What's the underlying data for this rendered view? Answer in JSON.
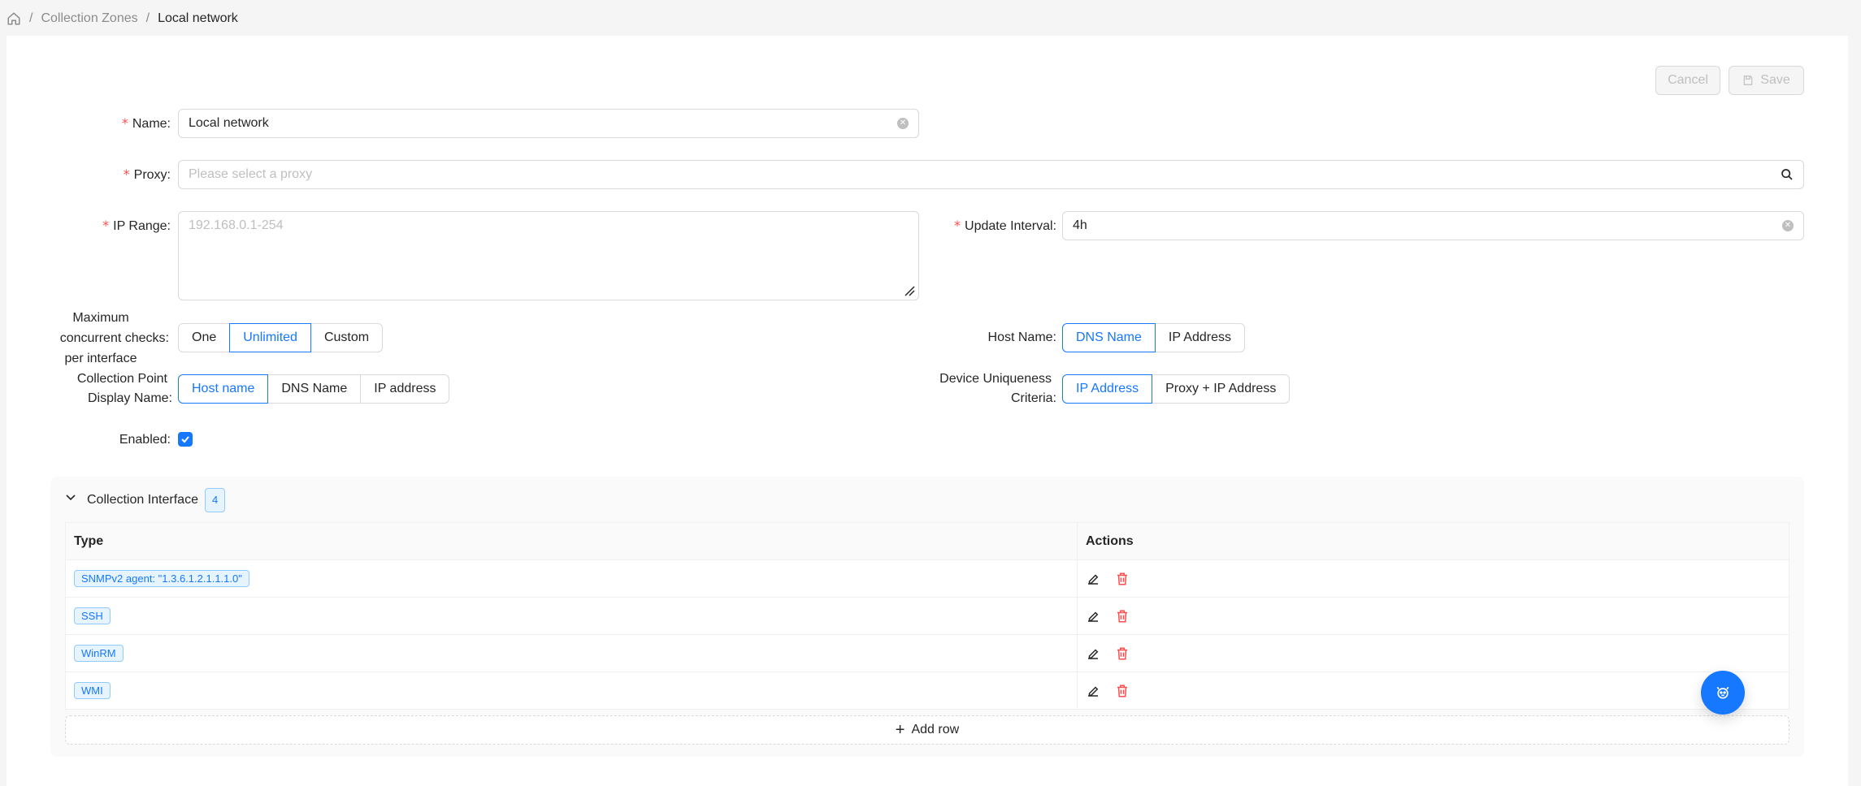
{
  "breadcrumb": {
    "home_icon": "home-icon",
    "items": [
      "Collection Zones",
      "Local network"
    ],
    "separator": "/"
  },
  "toolbar": {
    "cancel_label": "Cancel",
    "save_label": "Save"
  },
  "form": {
    "name": {
      "label": "Name",
      "value": "Local network"
    },
    "proxy": {
      "label": "Proxy",
      "placeholder": "Please select a proxy"
    },
    "ip_range": {
      "label": "IP Range",
      "placeholder": "192.168.0.1-254"
    },
    "update_interval": {
      "label": "Update Interval",
      "value": "4h"
    },
    "max_checks": {
      "label_lines": [
        "Maximum",
        "concurrent checks",
        "per interface"
      ],
      "options": [
        "One",
        "Unlimited",
        "Custom"
      ],
      "selected": "Unlimited"
    },
    "host_name": {
      "label": "Host Name",
      "options": [
        "DNS Name",
        "IP Address"
      ],
      "selected": "DNS Name"
    },
    "display_name": {
      "label_lines": [
        "Collection Point",
        "Display Name"
      ],
      "options": [
        "Host name",
        "DNS Name",
        "IP address"
      ],
      "selected": "Host name"
    },
    "uniqueness": {
      "label_lines": [
        "Device Uniqueness",
        "Criteria"
      ],
      "options": [
        "IP Address",
        "Proxy + IP Address"
      ],
      "selected": "IP Address"
    },
    "enabled": {
      "label": "Enabled",
      "checked": true
    }
  },
  "interfaces": {
    "title": "Collection Interface",
    "count": "4",
    "columns": [
      "Type",
      "Actions"
    ],
    "rows": [
      "SNMPv2 agent: \"1.3.6.1.2.1.1.1.0\"",
      "SSH",
      "WinRM",
      "WMI"
    ],
    "add_row_label": "Add row"
  },
  "colors": {
    "primary": "#1677ff",
    "danger": "#ff4d4f"
  }
}
